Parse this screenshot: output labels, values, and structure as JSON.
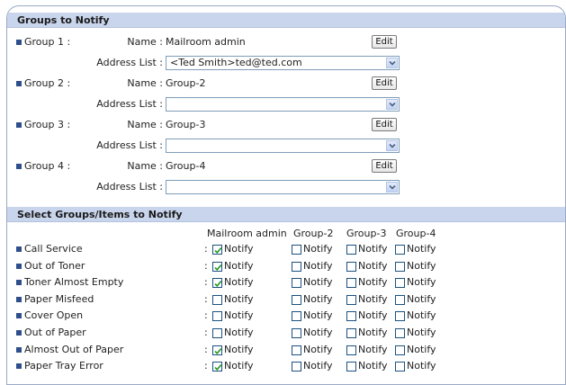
{
  "groups_section": {
    "title": "Groups to Notify",
    "name_label": "Name :",
    "address_label": "Address List :",
    "edit_label": "Edit",
    "groups": [
      {
        "label": "Group 1 :",
        "name": "Mailroom admin",
        "address": "<Ted Smith>ted@ted.com"
      },
      {
        "label": "Group 2 :",
        "name": "Group-2",
        "address": ""
      },
      {
        "label": "Group 3 :",
        "name": "Group-3",
        "address": ""
      },
      {
        "label": "Group 4 :",
        "name": "Group-4",
        "address": ""
      }
    ]
  },
  "items_section": {
    "title": "Select Groups/Items to Notify",
    "columns": [
      "Mailroom admin",
      "Group-2",
      "Group-3",
      "Group-4"
    ],
    "notify_label": "Notify",
    "items": [
      {
        "label": "Call Service",
        "checked": [
          true,
          false,
          false,
          false
        ]
      },
      {
        "label": "Out of Toner",
        "checked": [
          true,
          false,
          false,
          false
        ]
      },
      {
        "label": "Toner Almost Empty",
        "checked": [
          true,
          false,
          false,
          false
        ]
      },
      {
        "label": "Paper Misfeed",
        "checked": [
          false,
          false,
          false,
          false
        ]
      },
      {
        "label": "Cover Open",
        "checked": [
          false,
          false,
          false,
          false
        ]
      },
      {
        "label": "Out of Paper",
        "checked": [
          false,
          false,
          false,
          false
        ]
      },
      {
        "label": "Almost Out of Paper",
        "checked": [
          true,
          false,
          false,
          false
        ]
      },
      {
        "label": "Paper Tray Error",
        "checked": [
          true,
          false,
          false,
          false
        ]
      }
    ]
  },
  "colors": {
    "header_bg": "#c9d5ec",
    "bullet": "#2f4f8c",
    "checkmark": "#2a9a2a"
  }
}
